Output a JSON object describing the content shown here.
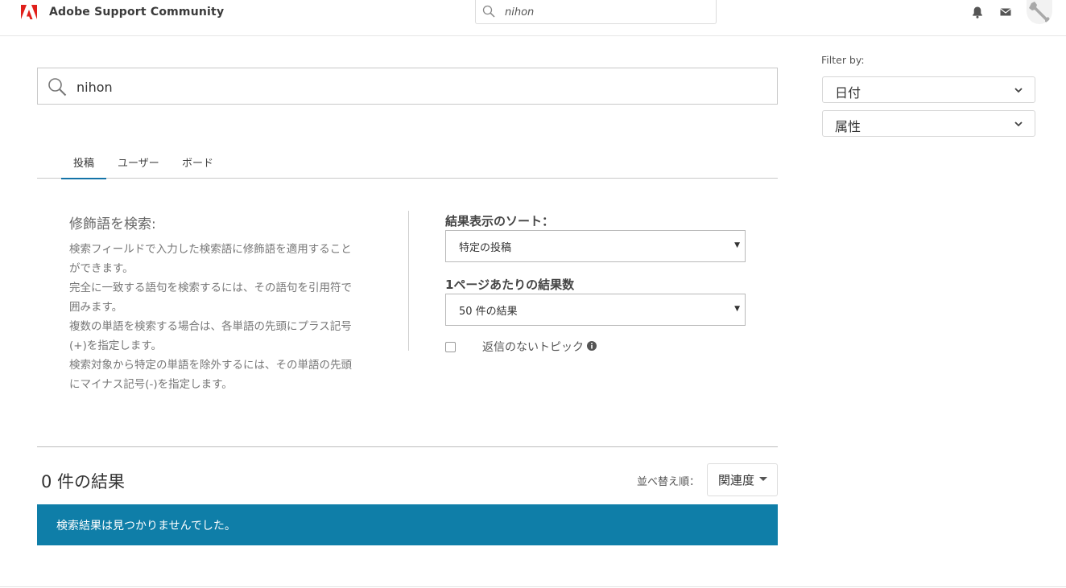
{
  "header": {
    "brand": "Adobe Support Community",
    "search_value": "nihon",
    "accent_color": "#e0201b"
  },
  "search": {
    "value": "nihon"
  },
  "tabs": [
    {
      "label": "投稿",
      "active": true
    },
    {
      "label": "ユーザー",
      "active": false
    },
    {
      "label": "ボード",
      "active": false
    }
  ],
  "help": {
    "title": "修飾語を検索:",
    "lines": [
      "検索フィールドで入力した検索語に修飾語を適用すること",
      "ができます。",
      "完全に一致する語句を検索するには、その語句を引用符で",
      "囲みます。",
      "複数の単語を検索する場合は、各単語の先頭にプラス記号",
      "(+)を指定します。",
      "検索対象から特定の単語を除外するには、その単語の先頭",
      "にマイナス記号(-)を指定します。"
    ]
  },
  "options": {
    "sort_label": "結果表示のソート：",
    "sort_value": "特定の投稿",
    "per_page_label": "1ページあたりの結果数",
    "per_page_value": "50 件の結果",
    "no_reply_label": "返信のないトピック",
    "no_reply_checked": false
  },
  "results": {
    "count_text": "0 件の結果",
    "sort_by_label": "並べ替え順：",
    "sort_by_value": "関連度",
    "empty_message": "検索結果は見つかりませんでした。",
    "banner_color": "#0f7ea8"
  },
  "filter": {
    "label": "Filter by:",
    "dropdowns": [
      {
        "label": "日付"
      },
      {
        "label": "属性"
      }
    ]
  }
}
